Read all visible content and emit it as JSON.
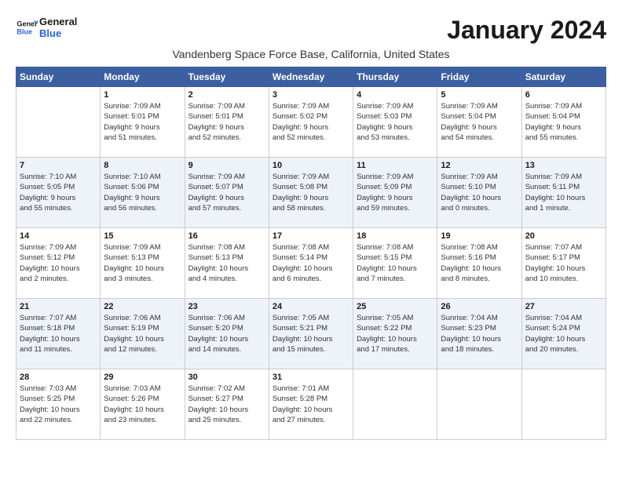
{
  "logo": {
    "line1": "General",
    "line2": "Blue"
  },
  "title": "January 2024",
  "subtitle": "Vandenberg Space Force Base, California, United States",
  "days_of_week": [
    "Sunday",
    "Monday",
    "Tuesday",
    "Wednesday",
    "Thursday",
    "Friday",
    "Saturday"
  ],
  "weeks": [
    [
      {
        "day": "",
        "data": ""
      },
      {
        "day": "1",
        "data": "Sunrise: 7:09 AM\nSunset: 5:01 PM\nDaylight: 9 hours\nand 51 minutes."
      },
      {
        "day": "2",
        "data": "Sunrise: 7:09 AM\nSunset: 5:01 PM\nDaylight: 9 hours\nand 52 minutes."
      },
      {
        "day": "3",
        "data": "Sunrise: 7:09 AM\nSunset: 5:02 PM\nDaylight: 9 hours\nand 52 minutes."
      },
      {
        "day": "4",
        "data": "Sunrise: 7:09 AM\nSunset: 5:03 PM\nDaylight: 9 hours\nand 53 minutes."
      },
      {
        "day": "5",
        "data": "Sunrise: 7:09 AM\nSunset: 5:04 PM\nDaylight: 9 hours\nand 54 minutes."
      },
      {
        "day": "6",
        "data": "Sunrise: 7:09 AM\nSunset: 5:04 PM\nDaylight: 9 hours\nand 55 minutes."
      }
    ],
    [
      {
        "day": "7",
        "data": "Sunrise: 7:10 AM\nSunset: 5:05 PM\nDaylight: 9 hours\nand 55 minutes."
      },
      {
        "day": "8",
        "data": "Sunrise: 7:10 AM\nSunset: 5:06 PM\nDaylight: 9 hours\nand 56 minutes."
      },
      {
        "day": "9",
        "data": "Sunrise: 7:09 AM\nSunset: 5:07 PM\nDaylight: 9 hours\nand 57 minutes."
      },
      {
        "day": "10",
        "data": "Sunrise: 7:09 AM\nSunset: 5:08 PM\nDaylight: 9 hours\nand 58 minutes."
      },
      {
        "day": "11",
        "data": "Sunrise: 7:09 AM\nSunset: 5:09 PM\nDaylight: 9 hours\nand 59 minutes."
      },
      {
        "day": "12",
        "data": "Sunrise: 7:09 AM\nSunset: 5:10 PM\nDaylight: 10 hours\nand 0 minutes."
      },
      {
        "day": "13",
        "data": "Sunrise: 7:09 AM\nSunset: 5:11 PM\nDaylight: 10 hours\nand 1 minute."
      }
    ],
    [
      {
        "day": "14",
        "data": "Sunrise: 7:09 AM\nSunset: 5:12 PM\nDaylight: 10 hours\nand 2 minutes."
      },
      {
        "day": "15",
        "data": "Sunrise: 7:09 AM\nSunset: 5:13 PM\nDaylight: 10 hours\nand 3 minutes."
      },
      {
        "day": "16",
        "data": "Sunrise: 7:08 AM\nSunset: 5:13 PM\nDaylight: 10 hours\nand 4 minutes."
      },
      {
        "day": "17",
        "data": "Sunrise: 7:08 AM\nSunset: 5:14 PM\nDaylight: 10 hours\nand 6 minutes."
      },
      {
        "day": "18",
        "data": "Sunrise: 7:08 AM\nSunset: 5:15 PM\nDaylight: 10 hours\nand 7 minutes."
      },
      {
        "day": "19",
        "data": "Sunrise: 7:08 AM\nSunset: 5:16 PM\nDaylight: 10 hours\nand 8 minutes."
      },
      {
        "day": "20",
        "data": "Sunrise: 7:07 AM\nSunset: 5:17 PM\nDaylight: 10 hours\nand 10 minutes."
      }
    ],
    [
      {
        "day": "21",
        "data": "Sunrise: 7:07 AM\nSunset: 5:18 PM\nDaylight: 10 hours\nand 11 minutes."
      },
      {
        "day": "22",
        "data": "Sunrise: 7:06 AM\nSunset: 5:19 PM\nDaylight: 10 hours\nand 12 minutes."
      },
      {
        "day": "23",
        "data": "Sunrise: 7:06 AM\nSunset: 5:20 PM\nDaylight: 10 hours\nand 14 minutes."
      },
      {
        "day": "24",
        "data": "Sunrise: 7:05 AM\nSunset: 5:21 PM\nDaylight: 10 hours\nand 15 minutes."
      },
      {
        "day": "25",
        "data": "Sunrise: 7:05 AM\nSunset: 5:22 PM\nDaylight: 10 hours\nand 17 minutes."
      },
      {
        "day": "26",
        "data": "Sunrise: 7:04 AM\nSunset: 5:23 PM\nDaylight: 10 hours\nand 18 minutes."
      },
      {
        "day": "27",
        "data": "Sunrise: 7:04 AM\nSunset: 5:24 PM\nDaylight: 10 hours\nand 20 minutes."
      }
    ],
    [
      {
        "day": "28",
        "data": "Sunrise: 7:03 AM\nSunset: 5:25 PM\nDaylight: 10 hours\nand 22 minutes."
      },
      {
        "day": "29",
        "data": "Sunrise: 7:03 AM\nSunset: 5:26 PM\nDaylight: 10 hours\nand 23 minutes."
      },
      {
        "day": "30",
        "data": "Sunrise: 7:02 AM\nSunset: 5:27 PM\nDaylight: 10 hours\nand 25 minutes."
      },
      {
        "day": "31",
        "data": "Sunrise: 7:01 AM\nSunset: 5:28 PM\nDaylight: 10 hours\nand 27 minutes."
      },
      {
        "day": "",
        "data": ""
      },
      {
        "day": "",
        "data": ""
      },
      {
        "day": "",
        "data": ""
      }
    ]
  ]
}
